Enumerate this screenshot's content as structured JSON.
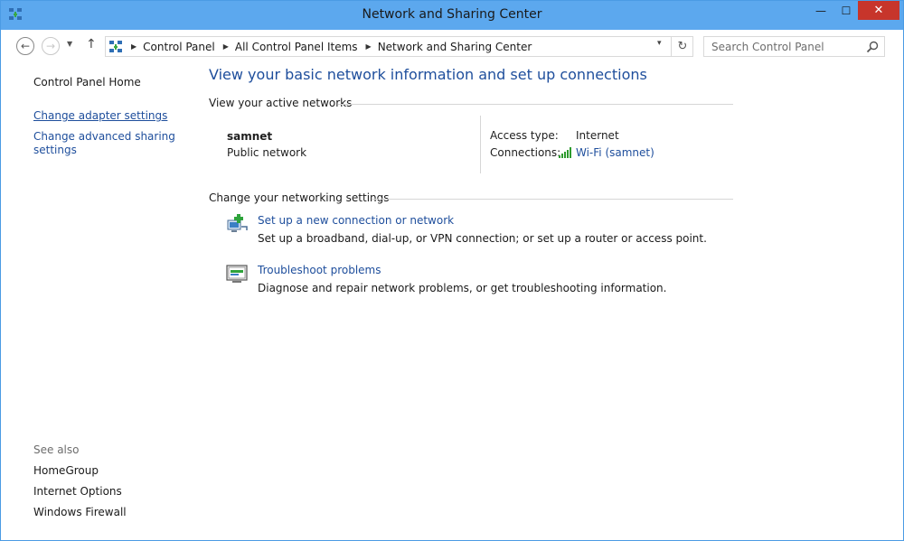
{
  "window": {
    "title": "Network and Sharing Center",
    "minimize_glyph": "—",
    "maximize_glyph": "☐",
    "close_glyph": "✕"
  },
  "nav": {
    "back_glyph": "←",
    "forward_glyph": "→",
    "recent_glyph": "▼",
    "up_glyph": "↑",
    "refresh_glyph": "↻",
    "dropdown_glyph": "▾"
  },
  "breadcrumb": [
    "Control Panel",
    "All Control Panel Items",
    "Network and Sharing Center"
  ],
  "search": {
    "placeholder": "Search Control Panel"
  },
  "sidebar": {
    "home": "Control Panel Home",
    "links": [
      "Change adapter settings",
      "Change advanced sharing settings"
    ],
    "see_also_title": "See also",
    "see_also": [
      "HomeGroup",
      "Internet Options",
      "Windows Firewall"
    ]
  },
  "main": {
    "title": "View your basic network information and set up connections",
    "active_networks_title": "View your active networks",
    "network": {
      "name": "samnet",
      "type": "Public network",
      "access_type_label": "Access type:",
      "access_type_value": "Internet",
      "connections_label": "Connections:",
      "connection_link": "Wi-Fi (samnet)"
    },
    "settings_title": "Change your networking settings",
    "tasks": [
      {
        "link": "Set up a new connection or network",
        "description": "Set up a broadband, dial-up, or VPN connection; or set up a router or access point."
      },
      {
        "link": "Troubleshoot problems",
        "description": "Diagnose and repair network problems, or get troubleshooting information."
      }
    ]
  },
  "colors": {
    "titlebar": "#5ca8ee",
    "close_button": "#c7352b",
    "link": "#1e4e9c",
    "wifi_green": "#2e9b2e"
  }
}
